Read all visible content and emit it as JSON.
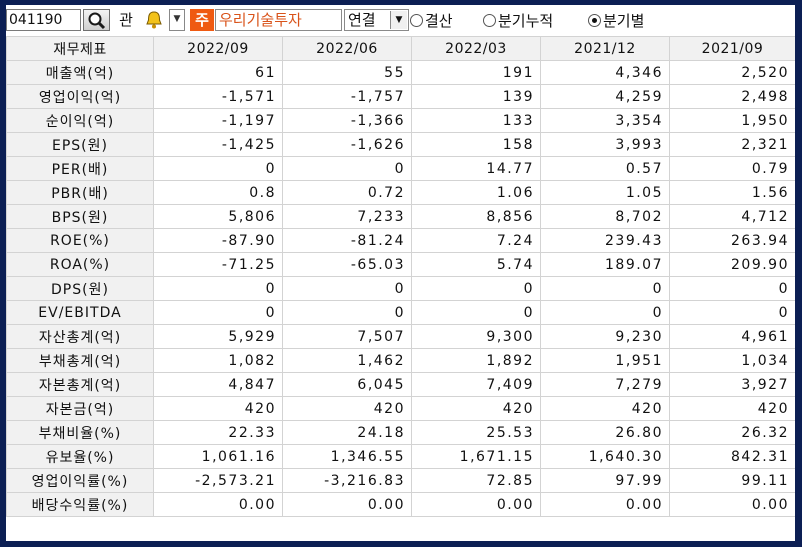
{
  "toolbar": {
    "stock_code": "041190",
    "kwan_label": "관",
    "ju_badge": "주",
    "company_name": "우리기술투자",
    "consolidation_select": "연결",
    "dropdown_arrow": "▼",
    "period_options": [
      {
        "label": "결산",
        "selected": false
      },
      {
        "label": "분기누적",
        "selected": false
      },
      {
        "label": "분기별",
        "selected": true
      }
    ],
    "icons": {
      "search": "magnifier-icon",
      "bell": "bell-icon"
    }
  },
  "table": {
    "corner_header": "재무제표",
    "columns": [
      "2022/09",
      "2022/06",
      "2022/03",
      "2021/12",
      "2021/09"
    ],
    "rows": [
      {
        "label": "매출액(억)",
        "values": [
          "61",
          "55",
          "191",
          "4,346",
          "2,520"
        ]
      },
      {
        "label": "영업이익(억)",
        "values": [
          "-1,571",
          "-1,757",
          "139",
          "4,259",
          "2,498"
        ]
      },
      {
        "label": "순이익(억)",
        "values": [
          "-1,197",
          "-1,366",
          "133",
          "3,354",
          "1,950"
        ]
      },
      {
        "label": "EPS(원)",
        "values": [
          "-1,425",
          "-1,626",
          "158",
          "3,993",
          "2,321"
        ]
      },
      {
        "label": "PER(배)",
        "values": [
          "0",
          "0",
          "14.77",
          "0.57",
          "0.79"
        ]
      },
      {
        "label": "PBR(배)",
        "values": [
          "0.8",
          "0.72",
          "1.06",
          "1.05",
          "1.56"
        ]
      },
      {
        "label": "BPS(원)",
        "values": [
          "5,806",
          "7,233",
          "8,856",
          "8,702",
          "4,712"
        ]
      },
      {
        "label": "ROE(%)",
        "values": [
          "-87.90",
          "-81.24",
          "7.24",
          "239.43",
          "263.94"
        ]
      },
      {
        "label": "ROA(%)",
        "values": [
          "-71.25",
          "-65.03",
          "5.74",
          "189.07",
          "209.90"
        ]
      },
      {
        "label": "DPS(원)",
        "values": [
          "0",
          "0",
          "0",
          "0",
          "0"
        ]
      },
      {
        "label": "EV/EBITDA",
        "values": [
          "0",
          "0",
          "0",
          "0",
          "0"
        ]
      },
      {
        "label": "자산총계(억)",
        "values": [
          "5,929",
          "7,507",
          "9,300",
          "9,230",
          "4,961"
        ]
      },
      {
        "label": "부채총계(억)",
        "values": [
          "1,082",
          "1,462",
          "1,892",
          "1,951",
          "1,034"
        ]
      },
      {
        "label": "자본총계(억)",
        "values": [
          "4,847",
          "6,045",
          "7,409",
          "7,279",
          "3,927"
        ]
      },
      {
        "label": "자본금(억)",
        "values": [
          "420",
          "420",
          "420",
          "420",
          "420"
        ]
      },
      {
        "label": "부채비율(%)",
        "values": [
          "22.33",
          "24.18",
          "25.53",
          "26.80",
          "26.32"
        ]
      },
      {
        "label": "유보율(%)",
        "values": [
          "1,061.16",
          "1,346.55",
          "1,671.15",
          "1,640.30",
          "842.31"
        ]
      },
      {
        "label": "영업이익률(%)",
        "values": [
          "-2,573.21",
          "-3,216.83",
          "72.85",
          "97.99",
          "99.11"
        ]
      },
      {
        "label": "배당수익률(%)",
        "values": [
          "0.00",
          "0.00",
          "0.00",
          "0.00",
          "0.00"
        ]
      }
    ]
  },
  "colors": {
    "background": "#0c1f54",
    "ju_badge": "#ef5a12",
    "company_text": "#d9531a",
    "header_bg": "#f1f1f1"
  }
}
